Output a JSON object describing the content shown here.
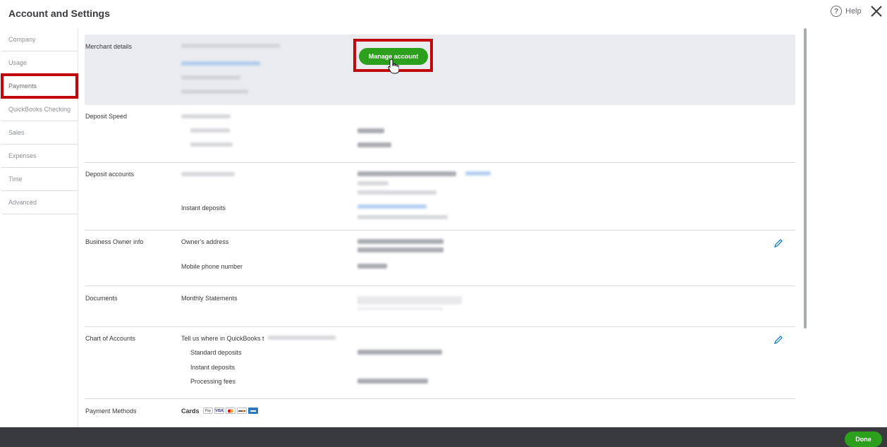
{
  "window": {
    "title": "Account and Settings",
    "help_label": "Help"
  },
  "sidebar": {
    "items": [
      {
        "label": "Company"
      },
      {
        "label": "Usage"
      },
      {
        "label": "Payments"
      },
      {
        "label": "QuickBooks Checking"
      },
      {
        "label": "Sales"
      },
      {
        "label": "Expenses"
      },
      {
        "label": "Time"
      },
      {
        "label": "Advanced"
      }
    ],
    "active": "Payments"
  },
  "sections": {
    "merchant": {
      "label": "Merchant details",
      "button": "Manage account"
    },
    "deposit_speed": {
      "label": "Deposit Speed"
    },
    "deposit_accounts": {
      "label": "Deposit accounts",
      "instant": "Instant deposits"
    },
    "business_owner": {
      "label": "Business Owner info",
      "address": "Owner's address",
      "phone": "Mobile phone number"
    },
    "documents": {
      "label": "Documents",
      "monthly": "Monthly Statements"
    },
    "chart_of_accounts": {
      "label": "Chart of Accounts",
      "intro": "Tell us where in QuickBooks t",
      "standard": "Standard deposits",
      "instant": "Instant deposits",
      "fees": "Processing fees"
    },
    "payment_methods": {
      "label": "Payment Methods",
      "cards": "Cards",
      "card_icons": [
        "apple-pay-icon",
        "visa-icon",
        "mastercard-icon",
        "discover-icon",
        "amex-icon"
      ],
      "card_texts": [
        "Pay",
        "VISA",
        "",
        "",
        ""
      ]
    }
  },
  "footer": {
    "done_label": "Done"
  },
  "colors": {
    "accent_green": "#2ca01c",
    "highlight_red": "#c0080c",
    "footer_bg": "#393a3d"
  }
}
